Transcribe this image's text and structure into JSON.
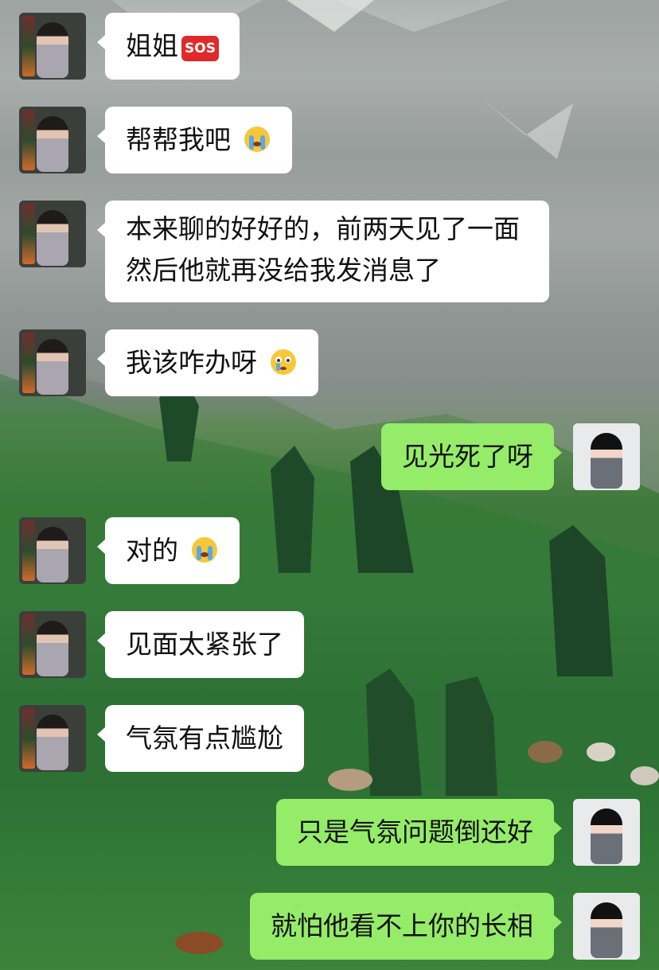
{
  "messages": [
    {
      "side": "in",
      "text": "姐姐",
      "emoji": "sos-icon",
      "sos_label": "SOS"
    },
    {
      "side": "in",
      "text": "帮帮我吧",
      "emoji": "crying-face-icon"
    },
    {
      "side": "in",
      "text": "本来聊的好好的，前两天见了一面然后他就再没给我发消息了"
    },
    {
      "side": "in",
      "text": "我该咋办呀",
      "emoji": "teary-face-icon"
    },
    {
      "side": "out",
      "text": "见光死了呀"
    },
    {
      "side": "in",
      "text": "对的",
      "emoji": "crying-face-icon"
    },
    {
      "side": "in",
      "text": "见面太紧张了"
    },
    {
      "side": "in",
      "text": "气氛有点尴尬"
    },
    {
      "side": "out",
      "text": "只是气氛问题倒还好"
    },
    {
      "side": "out",
      "text": "就怕他看不上你的长相"
    }
  ],
  "colors": {
    "incoming": "#ffffff",
    "outgoing": "#95ec69"
  }
}
